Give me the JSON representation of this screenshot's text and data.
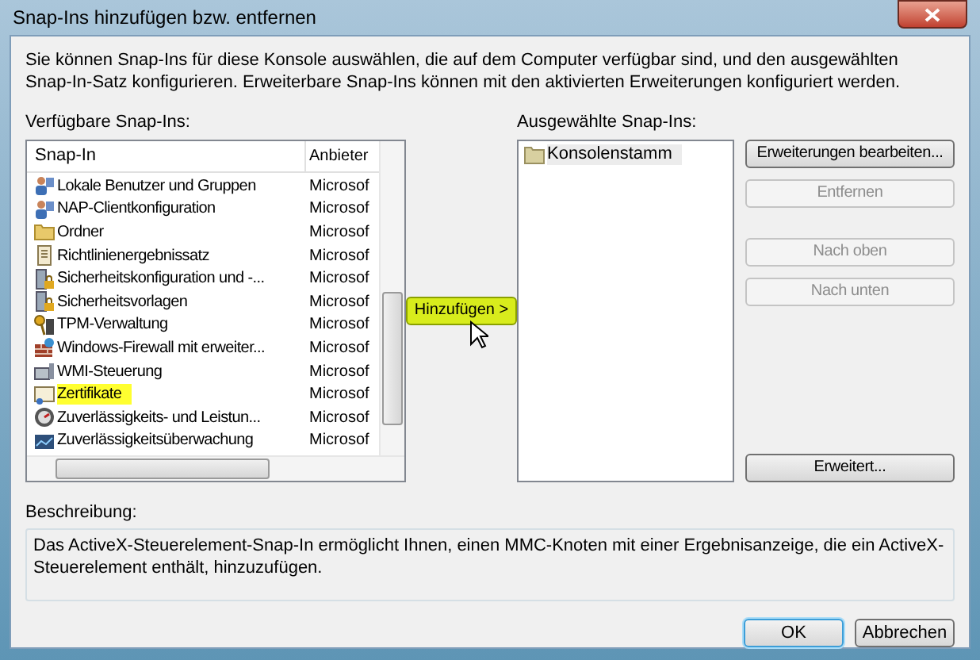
{
  "window": {
    "title": "Snap-Ins hinzufügen bzw. entfernen"
  },
  "intro": "Sie können Snap-Ins für diese Konsole auswählen, die auf dem Computer verfügbar sind, und den ausgewählten Snap-In-Satz konfigurieren. Erweiterbare Snap-Ins können mit den aktivierten Erweiterungen konfiguriert werden.",
  "available": {
    "label": "Verfügbare Snap-Ins:",
    "columns": [
      "Snap-In",
      "Anbieter"
    ],
    "rows": [
      {
        "name": "Lokale Benutzer und Gruppen",
        "vendor": "Microsof",
        "kind": "users",
        "highlighted": false
      },
      {
        "name": "NAP-Clientkonfiguration",
        "vendor": "Microsof",
        "kind": "users",
        "highlighted": false
      },
      {
        "name": "Ordner",
        "vendor": "Microsof",
        "kind": "folder",
        "highlighted": false
      },
      {
        "name": "Richtlinienergebnissatz",
        "vendor": "Microsof",
        "kind": "scroll",
        "highlighted": false
      },
      {
        "name": "Sicherheitskonfiguration und -...",
        "vendor": "Microsof",
        "kind": "lock",
        "highlighted": false
      },
      {
        "name": "Sicherheitsvorlagen",
        "vendor": "Microsof",
        "kind": "lock",
        "highlighted": false
      },
      {
        "name": "TPM-Verwaltung",
        "vendor": "Microsof",
        "kind": "key",
        "highlighted": false
      },
      {
        "name": "Windows-Firewall mit erweiter...",
        "vendor": "Microsof",
        "kind": "wall",
        "highlighted": false
      },
      {
        "name": "WMI-Steuerung",
        "vendor": "Microsof",
        "kind": "computer",
        "highlighted": false
      },
      {
        "name": "Zertifikate",
        "vendor": "Microsof",
        "kind": "certificate",
        "highlighted": true
      },
      {
        "name": "Zuverlässigkeits- und Leistun...",
        "vendor": "Microsof",
        "kind": "gauge",
        "highlighted": false
      },
      {
        "name": "Zuverlässigkeitsüberwachung",
        "vendor": "Microsof",
        "kind": "monitor",
        "highlighted": false
      }
    ]
  },
  "add_button": {
    "label": "Hinzufügen >",
    "highlighted": true
  },
  "selected_snapins": {
    "label": "Ausgewählte Snap-Ins:",
    "items": [
      {
        "name": "Konsolenstamm",
        "selected": true
      }
    ]
  },
  "side_buttons": [
    {
      "label": "Erweiterungen bearbeiten...",
      "disabled": false
    },
    {
      "label": "Entfernen",
      "disabled": true
    },
    {
      "label": "Nach oben",
      "disabled": true
    },
    {
      "label": "Nach unten",
      "disabled": true
    },
    {
      "label": "Erweitert...",
      "disabled": false
    }
  ],
  "description": {
    "label": "Beschreibung:",
    "text": "Das ActiveX-Steuerelement-Snap-In ermöglicht Ihnen, einen MMC-Knoten mit einer Ergebnisanzeige, die ein ActiveX-Steuerelement enthält, hinzuzufügen."
  },
  "buttons": [
    {
      "label": "OK",
      "default": true
    },
    {
      "label": "Abbrechen",
      "default": false
    }
  ]
}
